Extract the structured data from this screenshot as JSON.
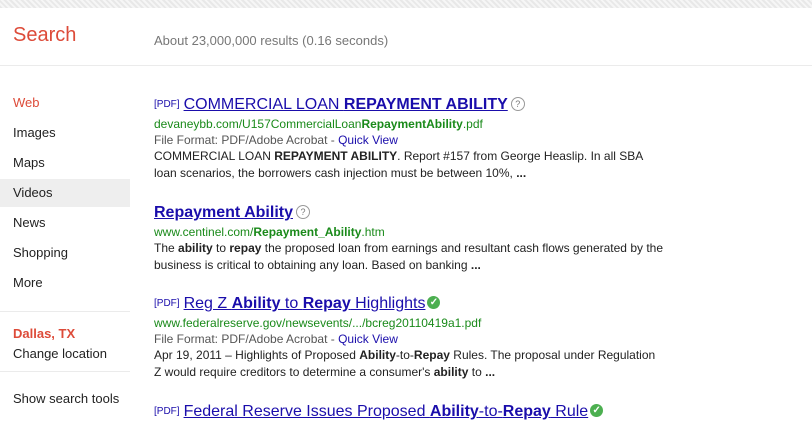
{
  "header": {
    "title": "Search",
    "result_stats": "About 23,000,000 results (0.16 seconds)"
  },
  "sidebar": {
    "items": [
      {
        "label": "Web",
        "active": true
      },
      {
        "label": "Images"
      },
      {
        "label": "Maps"
      },
      {
        "label": "Videos"
      },
      {
        "label": "News"
      },
      {
        "label": "Shopping"
      },
      {
        "label": "More"
      }
    ],
    "location": {
      "city": "Dallas, TX",
      "change": "Change location"
    },
    "tools": "Show search tools"
  },
  "results": [
    {
      "badge": "[PDF]",
      "title": [
        {
          "t": "COMMERCIAL LOAN "
        },
        {
          "t": "REPAYMENT ABILITY",
          "b": true
        }
      ],
      "icon": "question-icon",
      "url": [
        {
          "t": "devaneybb.com/U157CommercialLoan"
        },
        {
          "t": "RepaymentAbility",
          "b": true
        },
        {
          "t": ".pdf"
        }
      ],
      "meta": {
        "prefix": "File Format: PDF/Adobe Acrobat - ",
        "link": "Quick View"
      },
      "snippet": [
        {
          "t": "COMMERCIAL LOAN "
        },
        {
          "t": "REPAYMENT ABILITY",
          "b": true
        },
        {
          "t": ". Report #157 from George Heaslip. In all SBA loan scenarios, the borrowers cash injection must be between 10%, "
        },
        {
          "t": "...",
          "b": true
        }
      ]
    },
    {
      "badge": "",
      "title": [
        {
          "t": "Repayment Ability",
          "b": true
        }
      ],
      "icon": "question-icon",
      "url": [
        {
          "t": "www.centinel.com/"
        },
        {
          "t": "Repayment_Ability",
          "b": true
        },
        {
          "t": ".htm"
        }
      ],
      "meta": null,
      "snippet": [
        {
          "t": "The "
        },
        {
          "t": "ability",
          "b": true
        },
        {
          "t": " to "
        },
        {
          "t": "repay",
          "b": true
        },
        {
          "t": " the proposed loan from earnings and resultant cash flows generated by the business is critical to obtaining any loan. Based on banking "
        },
        {
          "t": "...",
          "b": true
        }
      ]
    },
    {
      "badge": "[PDF]",
      "title": [
        {
          "t": "Reg Z "
        },
        {
          "t": "Ability",
          "b": true
        },
        {
          "t": " to "
        },
        {
          "t": "Repay",
          "b": true
        },
        {
          "t": " Highlights"
        }
      ],
      "icon": "verified-icon",
      "url": [
        {
          "t": "www.federalreserve.gov/newsevents/.../bcreg20110419a1.pdf"
        }
      ],
      "meta": {
        "prefix": "File Format: PDF/Adobe Acrobat - ",
        "link": "Quick View"
      },
      "snippet": [
        {
          "t": "Apr 19, 2011 – Highlights of Proposed "
        },
        {
          "t": "Ability",
          "b": true
        },
        {
          "t": "-to-"
        },
        {
          "t": "Repay",
          "b": true
        },
        {
          "t": " Rules. The proposal under Regulation Z would require creditors to determine a consumer's "
        },
        {
          "t": "ability",
          "b": true
        },
        {
          "t": " to "
        },
        {
          "t": "...",
          "b": true
        }
      ]
    },
    {
      "badge": "[PDF]",
      "title": [
        {
          "t": "Federal Reserve Issues Proposed "
        },
        {
          "t": "Ability",
          "b": true
        },
        {
          "t": "-to-"
        },
        {
          "t": "Repay",
          "b": true
        },
        {
          "t": " Rule"
        }
      ],
      "icon": "verified-icon",
      "url": null,
      "meta": null,
      "snippet": null
    }
  ],
  "colors": {
    "accent": "#dd4b39",
    "link": "#1a0dab",
    "url": "#1a8a1a"
  }
}
